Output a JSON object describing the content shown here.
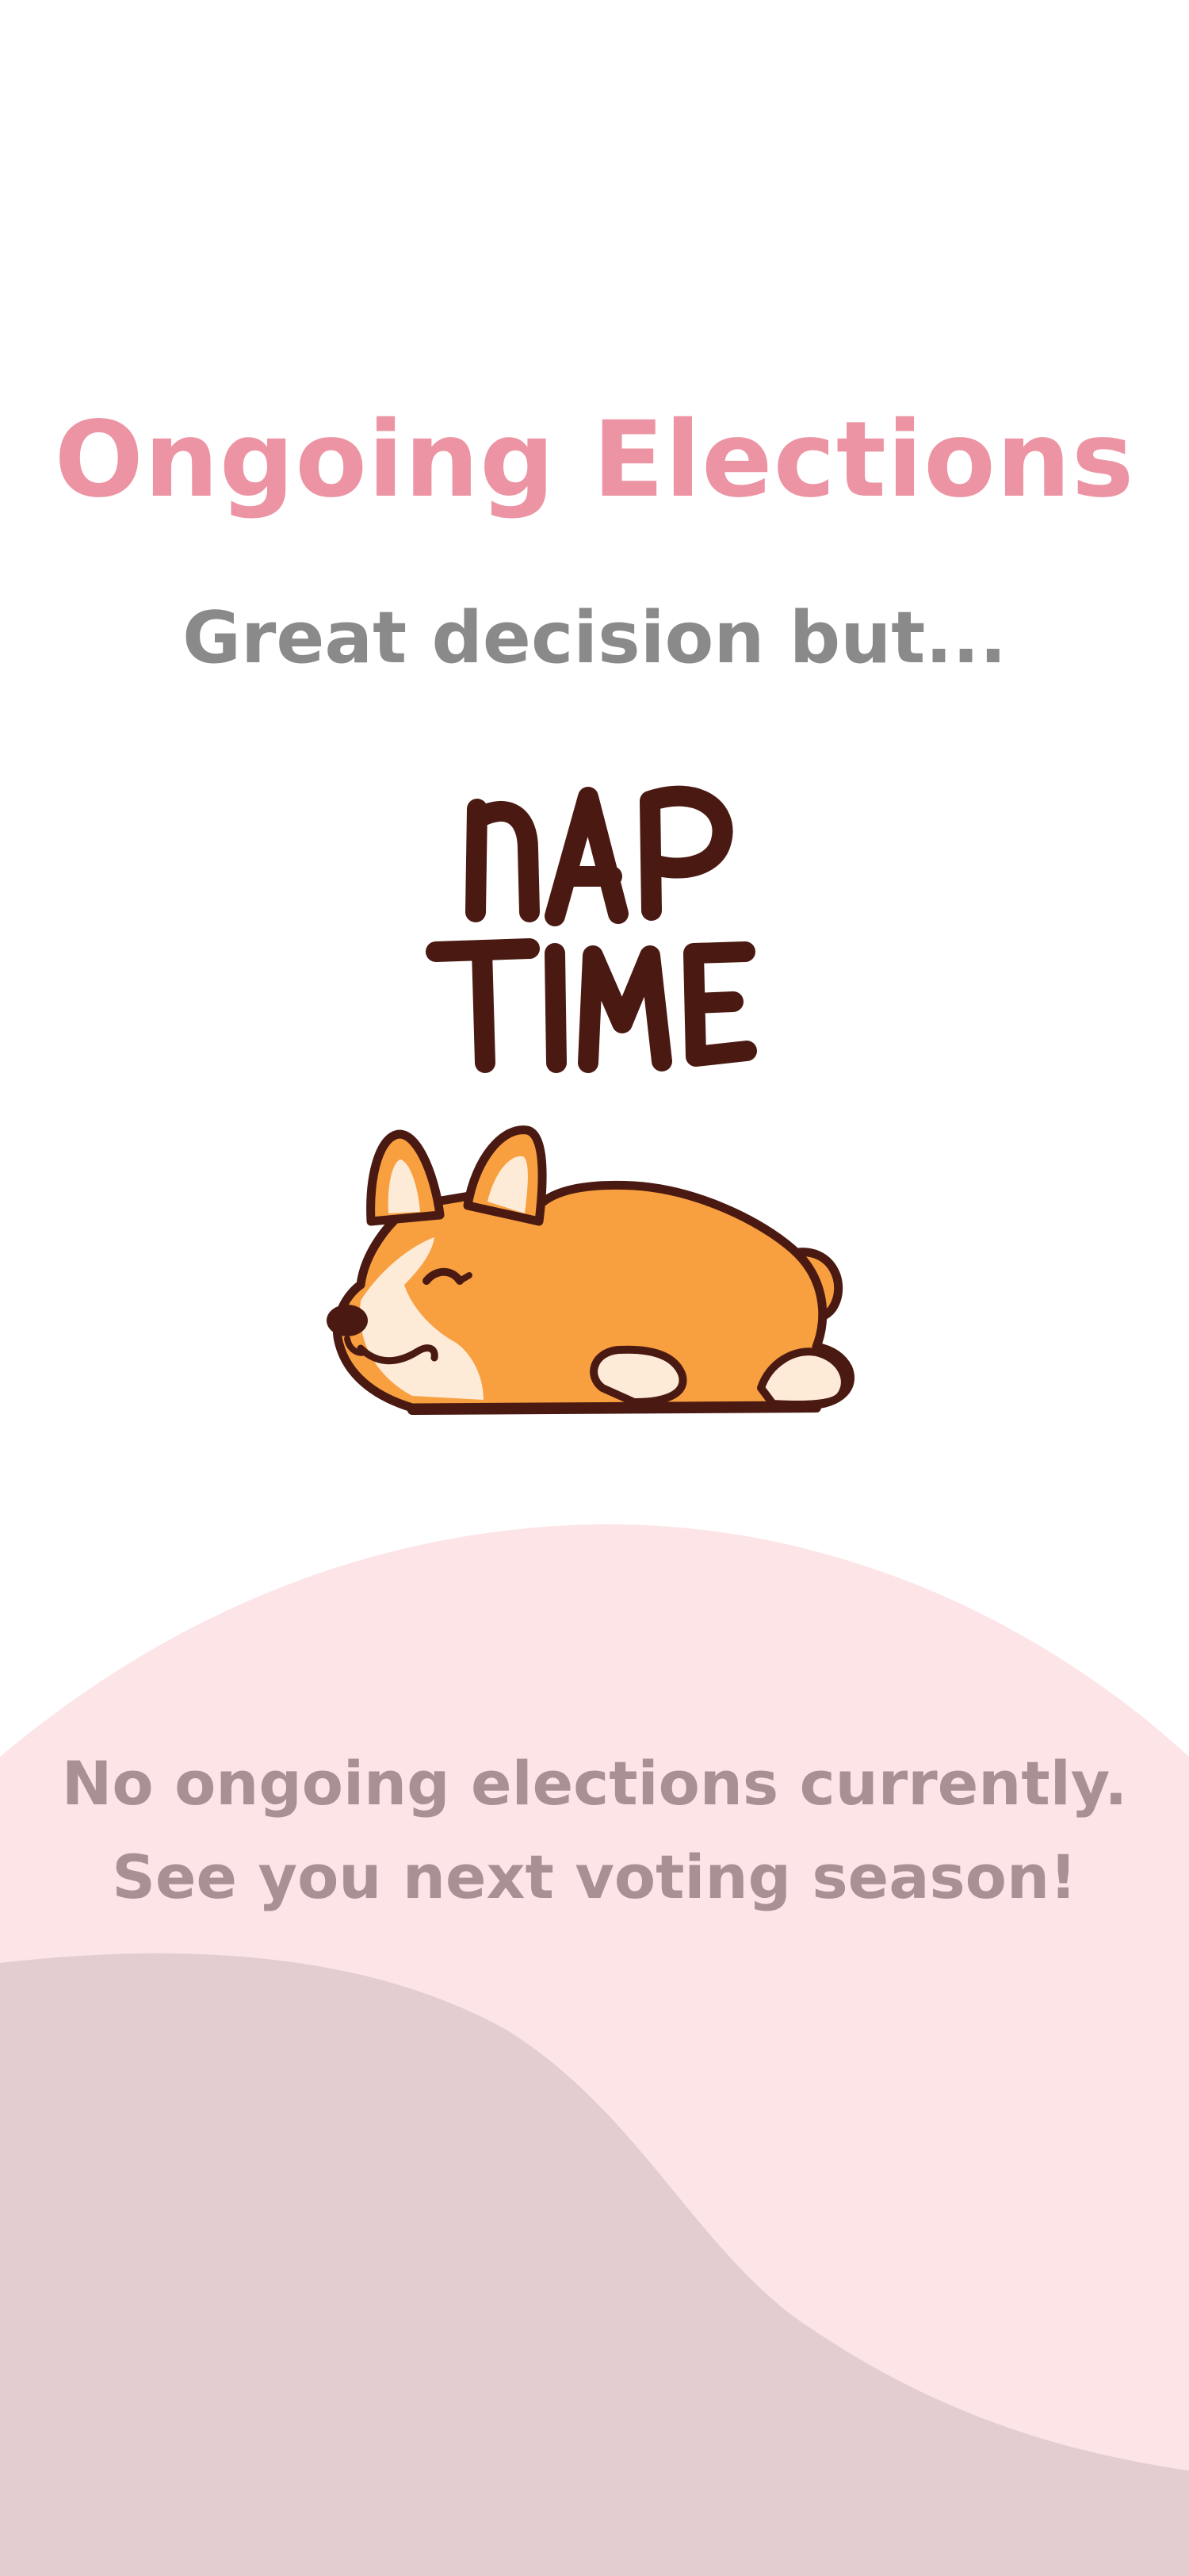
{
  "page": {
    "title": "Ongoing Elections",
    "subtitle": "Great decision but...",
    "illustration": {
      "icon": "sleeping-corgi-icon",
      "caption_line1": "NAP",
      "caption_line2": "TIME"
    },
    "empty_state": {
      "line1": "No ongoing elections currently.",
      "line2": "See you next voting season!"
    }
  },
  "colors": {
    "title": "#ec94a3",
    "subtitle": "#8a8a8a",
    "message": "#a89095",
    "wave_light": "#fce4e7",
    "wave_dark": "#e4cdd0",
    "corgi_orange": "#f8a040",
    "corgi_outline": "#4a1a12",
    "corgi_cream": "#fdebd8"
  }
}
